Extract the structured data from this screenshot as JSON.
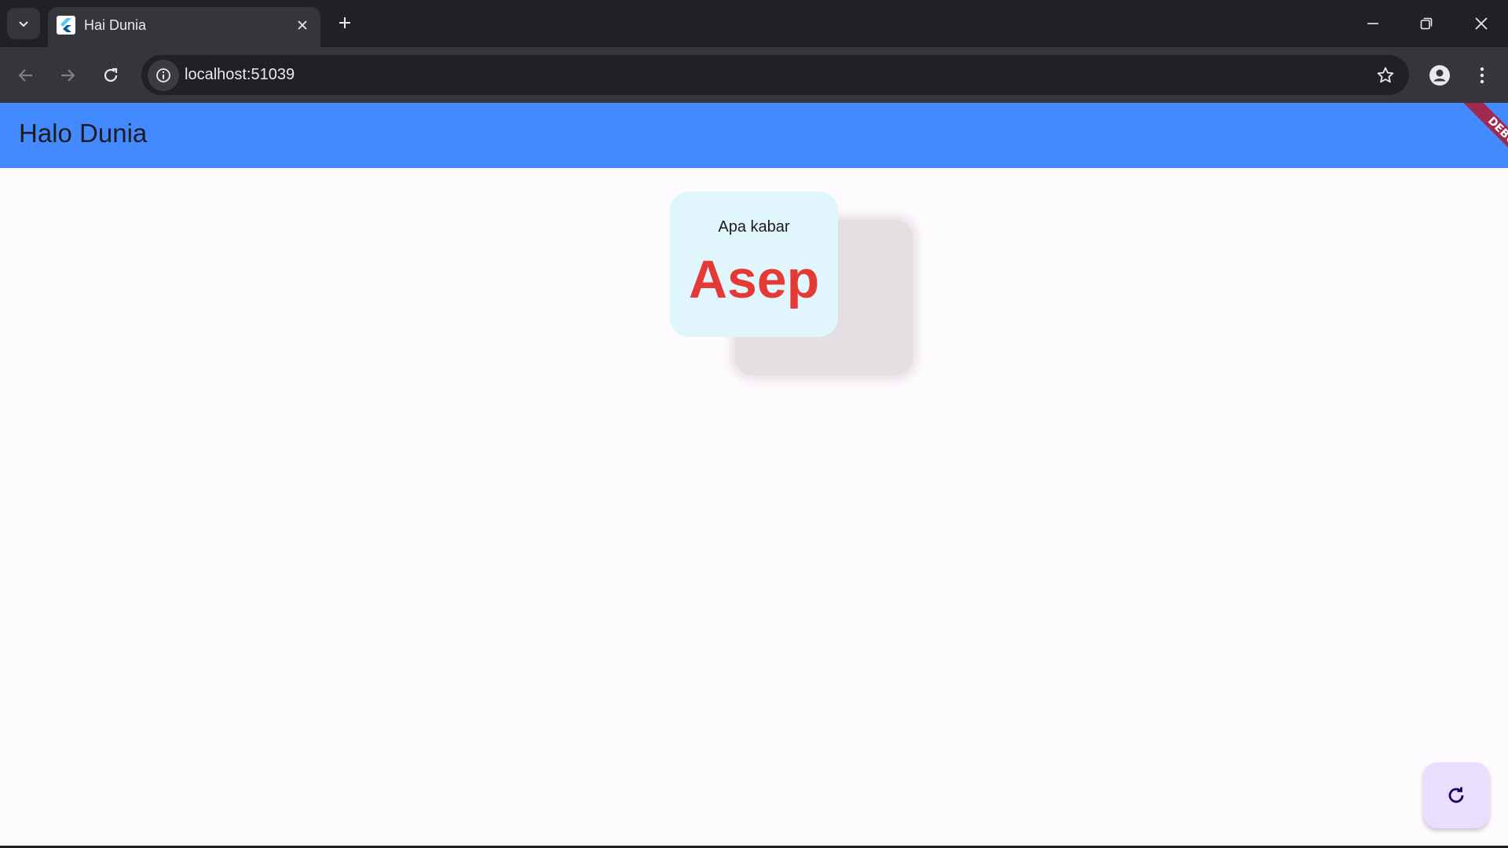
{
  "browser": {
    "tab": {
      "title": "Hai Dunia",
      "favicon": "flutter-logo-icon"
    },
    "address": {
      "url": "localhost:51039"
    },
    "icons": {
      "tab_search": "chevron-down-icon",
      "tab_close": "close-icon",
      "new_tab": "plus-icon",
      "minimize": "minimize-icon",
      "restore": "restore-icon",
      "close_window": "close-icon",
      "back": "arrow-left-icon",
      "forward": "arrow-right-icon",
      "reload": "reload-icon",
      "site_info": "info-icon",
      "bookmark": "star-icon",
      "profile": "person-icon",
      "menu": "kebab-menu-icon"
    }
  },
  "app": {
    "appbar": {
      "title": "Halo Dunia",
      "color": "#448aff"
    },
    "debug_banner": "DEBUG",
    "card": {
      "greeting": "Apa kabar",
      "name": "Asep",
      "name_color": "#e53935",
      "background": "#e1f5fd"
    },
    "fab": {
      "icon": "refresh-icon",
      "background": "#eadeff"
    }
  }
}
